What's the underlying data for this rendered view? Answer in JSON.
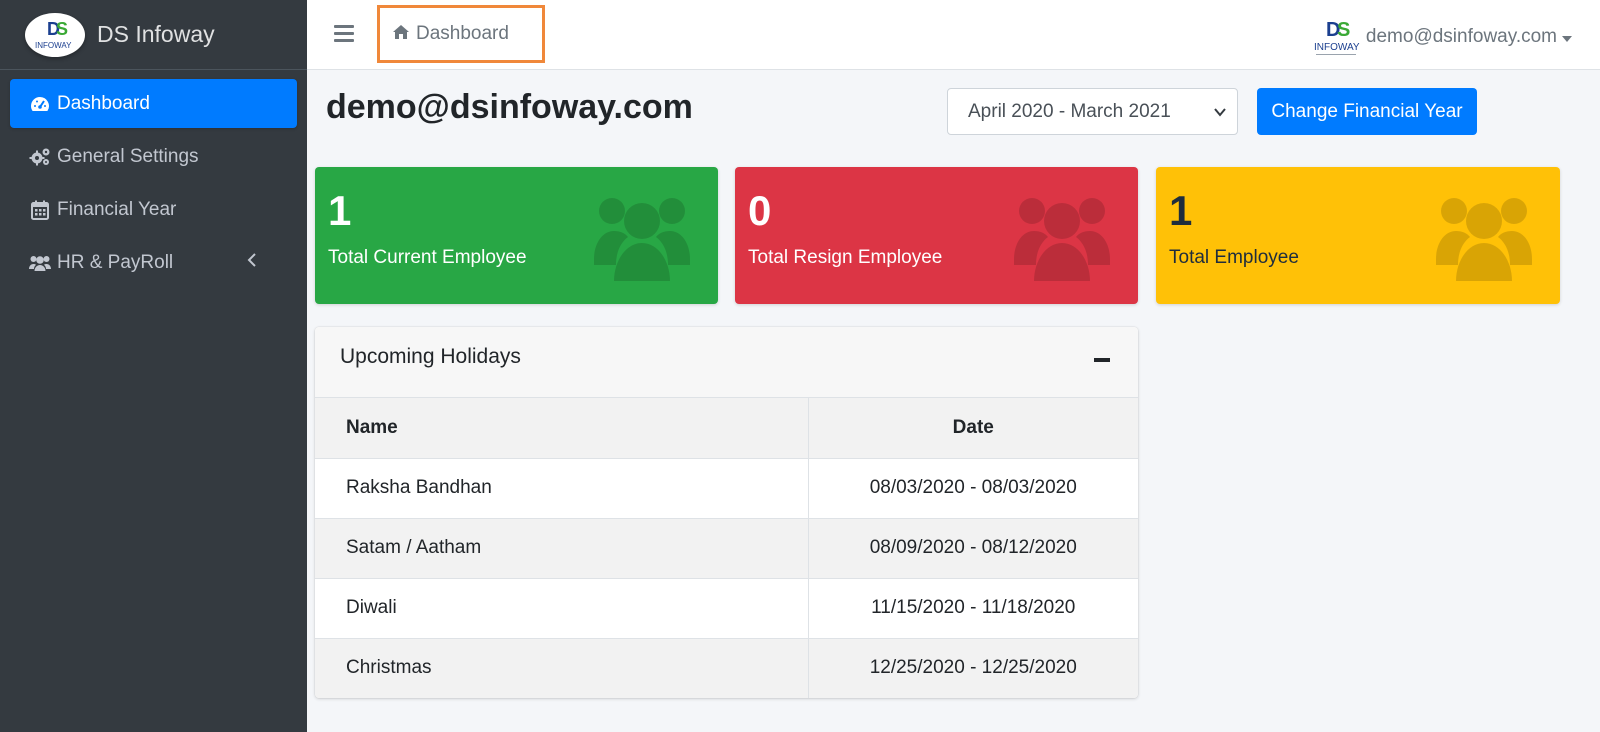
{
  "brand": {
    "name": "DS Infoway",
    "logo_text": "DS",
    "logo_subtext": "INFOWAY"
  },
  "sidebar": {
    "items": [
      {
        "label": "Dashboard",
        "icon": "tachometer-icon",
        "active": true
      },
      {
        "label": "General Settings",
        "icon": "cogs-icon"
      },
      {
        "label": "Financial Year",
        "icon": "calendar-icon"
      },
      {
        "label": "HR & PayRoll",
        "icon": "users-icon",
        "expandable": true
      }
    ]
  },
  "topbar": {
    "breadcrumb": "Dashboard",
    "user_email": "demo@dsinfoway.com"
  },
  "main": {
    "title": "demo@dsinfoway.com",
    "financial_year_selected": "April 2020 - March 2021",
    "change_fy_button": "Change Financial Year"
  },
  "stats": [
    {
      "value": "1",
      "label": "Total Current Employee",
      "color": "#28a745"
    },
    {
      "value": "0",
      "label": "Total Resign Employee",
      "color": "#dc3545"
    },
    {
      "value": "1",
      "label": "Total Employee",
      "color": "#ffc107"
    }
  ],
  "holidays": {
    "title": "Upcoming Holidays",
    "columns": [
      "Name",
      "Date"
    ],
    "rows": [
      {
        "name": "Raksha Bandhan",
        "date": "08/03/2020 - 08/03/2020"
      },
      {
        "name": "Satam / Aatham",
        "date": "08/09/2020 - 08/12/2020"
      },
      {
        "name": "Diwali",
        "date": "11/15/2020 - 11/18/2020"
      },
      {
        "name": "Christmas",
        "date": "12/25/2020 - 12/25/2020"
      }
    ]
  },
  "colors": {
    "primary": "#007bff",
    "sidebar_bg": "#343a40",
    "highlight": "#f0883a"
  }
}
